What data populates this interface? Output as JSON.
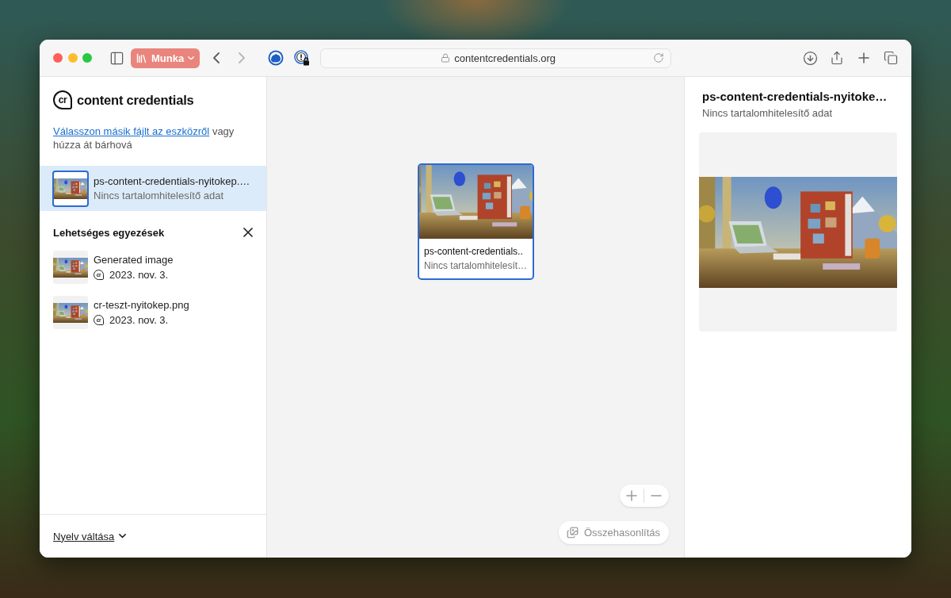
{
  "toolbar": {
    "tab_group": {
      "label": "Munka"
    },
    "navigation": [
      {
        "kind": "back",
        "disabled": false
      },
      {
        "kind": "forward",
        "disabled": true
      }
    ],
    "address_bar": {
      "value": "contentcredentials.org"
    }
  },
  "sidebar": {
    "brand": {
      "mark": "cr",
      "name": "content credentials"
    },
    "upload_hint": {
      "link": "Válasszon másik fájlt az eszközről",
      "text": "vagy húzza át bárhová"
    },
    "files": [
      {
        "name": "ps-content-credentials-nyitokep.…",
        "status": "Nincs tartalomhitelesítő adat",
        "selected": true
      }
    ],
    "matches": {
      "title": "Lehetséges egyezések",
      "items": [
        {
          "name": "Generated image",
          "badge": "cr",
          "date": "2023. nov. 3."
        },
        {
          "name": "cr-teszt-nyitokep.png",
          "badge": "cr",
          "date": "2023. nov. 3."
        }
      ]
    },
    "language": {
      "label": "Nyelv váltása"
    }
  },
  "canvas": {
    "cards": [
      {
        "name": "ps-content-credentials..",
        "status": "Nincs tartalomhitelesít…",
        "selected": true
      }
    ],
    "compare_button": {
      "label": "Összehasonlítás",
      "disabled": true
    }
  },
  "details": {
    "title": "ps-content-credentials-nyitoke…",
    "status": "Nincs tartalomhitelesítő adat"
  }
}
